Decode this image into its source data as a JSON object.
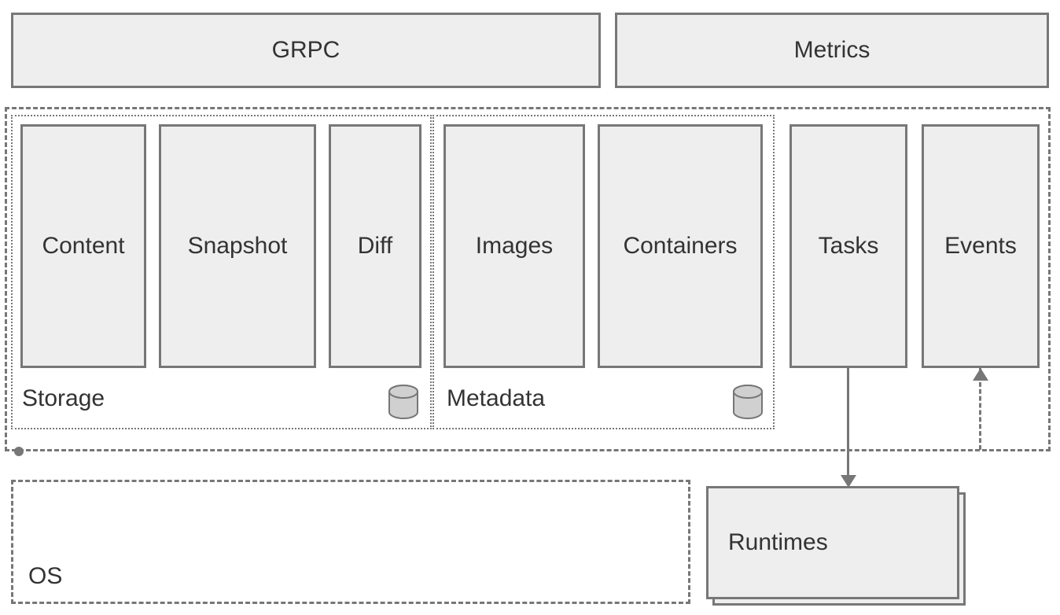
{
  "top": {
    "grpc": "GRPC",
    "metrics": "Metrics"
  },
  "storage": {
    "label": "Storage",
    "items": {
      "content": "Content",
      "snapshot": "Snapshot",
      "diff": "Diff"
    }
  },
  "metadata": {
    "label": "Metadata",
    "items": {
      "images": "Images",
      "containers": "Containers"
    }
  },
  "tasks": "Tasks",
  "events": "Events",
  "runtimes": "Runtimes",
  "os": "OS"
}
